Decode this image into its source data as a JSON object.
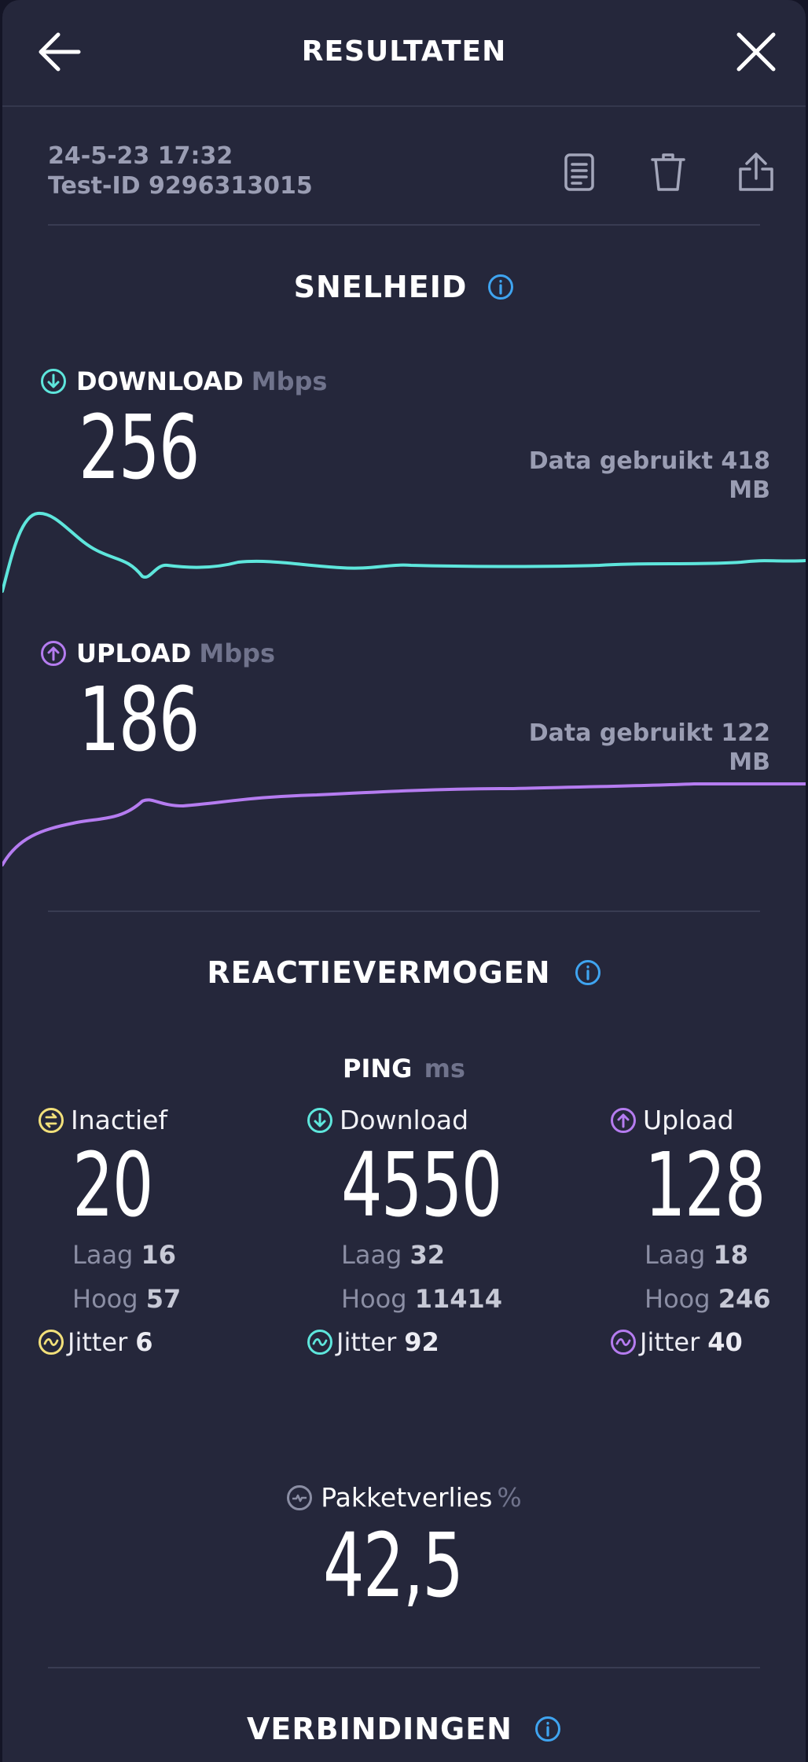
{
  "header": {
    "title": "RESULTATEN"
  },
  "meta": {
    "datetime": "24-5-23 17:32",
    "test_id": "Test-ID 9296313015"
  },
  "speed": {
    "title": "SNELHEID",
    "download": {
      "label": "DOWNLOAD",
      "unit": "Mbps",
      "value": "256",
      "data_used": "Data gebruikt 418",
      "data_unit": "MB"
    },
    "upload": {
      "label": "UPLOAD",
      "unit": "Mbps",
      "value": "186",
      "data_used": "Data gebruikt 122",
      "data_unit": "MB"
    }
  },
  "responsiveness": {
    "title": "REACTIEVERMOGEN",
    "ping": {
      "label": "PING",
      "unit": "ms"
    },
    "columns": [
      {
        "label": "Inactief",
        "value": "20",
        "low_label": "Laag",
        "low": "16",
        "high_label": "Hoog",
        "high": "57",
        "jitter_label": "Jitter",
        "jitter": "6"
      },
      {
        "label": "Download",
        "value": "4550",
        "low_label": "Laag",
        "low": "32",
        "high_label": "Hoog",
        "high": "11414",
        "jitter_label": "Jitter",
        "jitter": "92"
      },
      {
        "label": "Upload",
        "value": "128",
        "low_label": "Laag",
        "low": "18",
        "high_label": "Hoog",
        "high": "246",
        "jitter_label": "Jitter",
        "jitter": "40"
      }
    ],
    "packet_loss": {
      "label": "Pakketverlies",
      "unit": "%",
      "value": "42,5"
    }
  },
  "connections": {
    "title": "VERBINDINGEN"
  },
  "colors": {
    "download": "#5ee6dc",
    "upload": "#b57cf0",
    "idle": "#f2e07a",
    "info": "#3fa4f0",
    "background": "#25273b"
  },
  "icons": {
    "back": "arrow-left-icon",
    "close": "close-icon",
    "report": "document-icon",
    "delete": "trash-icon",
    "share": "share-icon",
    "info": "info-icon"
  }
}
